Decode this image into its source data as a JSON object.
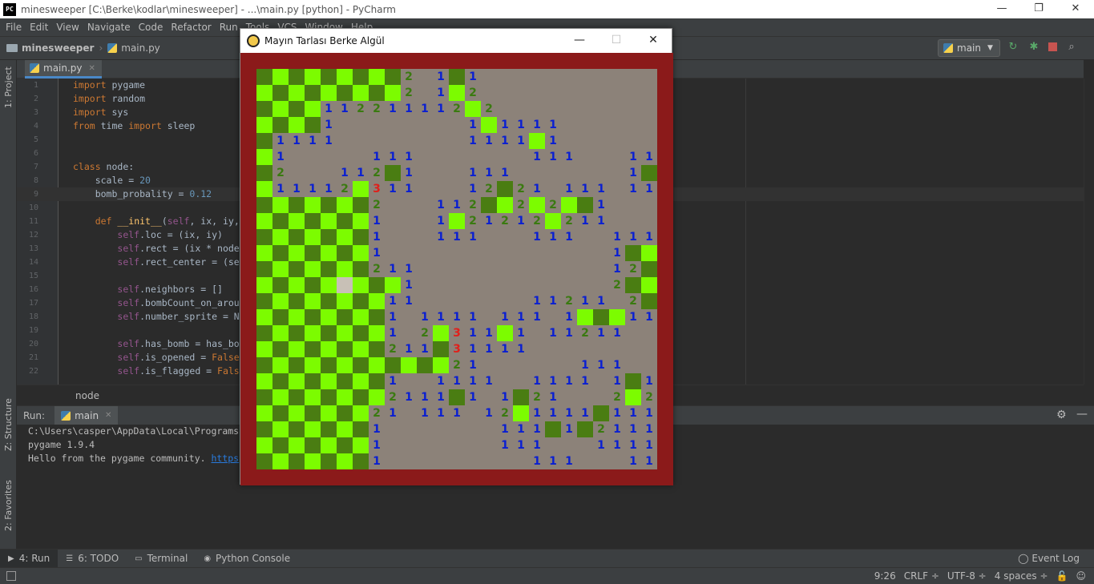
{
  "window": {
    "title": "minesweeper [C:\\Berke\\kodlar\\minesweeper] - ...\\main.py [python] - PyCharm",
    "app_icon": "PC",
    "minimize": "—",
    "maximize": "❐",
    "close": "✕"
  },
  "menu": [
    "File",
    "Edit",
    "View",
    "Navigate",
    "Code",
    "Refactor",
    "Run",
    "Tools",
    "VCS",
    "Window",
    "Help"
  ],
  "navbar": {
    "project": "minesweeper",
    "file": "main.py",
    "run_config": "main",
    "run_config_caret": "▼"
  },
  "sidebar": {
    "project_label": "1: Project",
    "structure_label": "Z: Structure",
    "favorites_label": "2: Favorites"
  },
  "editor_tab": {
    "label": "main.py",
    "close": "✕"
  },
  "code_lines": [
    {
      "n": "1",
      "html": "<span class='kw'>import</span> pygame"
    },
    {
      "n": "2",
      "html": "<span class='kw'>import</span> random"
    },
    {
      "n": "3",
      "html": "<span class='kw'>import</span> sys"
    },
    {
      "n": "4",
      "html": "<span class='kw'>from</span> time <span class='kw'>import</span> sleep"
    },
    {
      "n": "5",
      "html": ""
    },
    {
      "n": "6",
      "html": ""
    },
    {
      "n": "7",
      "html": "<span class='kw'>class</span> node:"
    },
    {
      "n": "8",
      "html": "    scale = <span class='num'>20</span>"
    },
    {
      "n": "9",
      "html": "    bomb_probality = <span class='num'>0.12</span>"
    },
    {
      "n": "10",
      "html": ""
    },
    {
      "n": "11",
      "html": "    <span class='kw'>def</span> <span class='fn'>__init__</span>(<span class='self'>self</span>, ix, iy,"
    },
    {
      "n": "12",
      "html": "        <span class='self'>self</span>.loc = (ix, iy)"
    },
    {
      "n": "13",
      "html": "        <span class='self'>self</span>.rect = (ix * node"
    },
    {
      "n": "14",
      "html": "        <span class='self'>self</span>.rect_center = (se"
    },
    {
      "n": "15",
      "html": ""
    },
    {
      "n": "16",
      "html": "        <span class='self'>self</span>.neighbors = []"
    },
    {
      "n": "17",
      "html": "        <span class='self'>self</span>.bombCount_on_arou"
    },
    {
      "n": "18",
      "html": "        <span class='self'>self</span>.number_sprite = N"
    },
    {
      "n": "19",
      "html": ""
    },
    {
      "n": "20",
      "html": "        <span class='self'>self</span>.has_bomb = has_bo"
    },
    {
      "n": "21",
      "html": "        <span class='self'>self</span>.is_opened = <span class='kw'>False</span>"
    },
    {
      "n": "22",
      "html": "        <span class='self'>self</span>.is_flagged = <span class='kw'>Fals</span>"
    }
  ],
  "editor_breadcrumb": "node",
  "run_panel": {
    "label": "Run:",
    "tab": "main",
    "tab_close": "✕",
    "lines": [
      "C:\\Users\\casper\\AppData\\Local\\Programs",
      "pygame 1.9.4"
    ],
    "hello_text": "Hello from the pygame community. ",
    "hello_link": "https"
  },
  "bottom_tabs": [
    {
      "label": "4: Run",
      "icon": "▶",
      "active": true
    },
    {
      "label": "6: TODO",
      "icon": "☰",
      "active": false
    },
    {
      "label": "Terminal",
      "icon": "▭",
      "active": false
    },
    {
      "label": "Python Console",
      "icon": "◉",
      "active": false
    }
  ],
  "event_log": "Event Log",
  "status": {
    "position": "9:26",
    "line_sep": "CRLF ÷",
    "encoding": "UTF-8 ÷",
    "indent": "4 spaces ÷"
  },
  "game": {
    "title": "Mayın Tarlası Berke Algül",
    "minimize": "—",
    "maximize": "☐",
    "close": "✕",
    "colors": {
      "dark_green": "#4a7d12",
      "light_green": "#7cfc00",
      "opened": "#8c8279",
      "flag": "#c8c0b6",
      "border": "#8b1a1a",
      "num_1": "#0a1fd1",
      "num_2": "#3a7a10",
      "num_3": "#e0201b"
    },
    "grid_cols": 25,
    "grid": [
      "#########2.1#1...........",
      "#########2.1#2...........",
      "####112211112#2..........",
      "####1........1#1111......",
      "#1111........1111#1......",
      "#1.....111.......111...11",
      "#2...112#1...111.......1#",
      "#11112#311...12#21.111.11",
      "#######2...112##2#2##1...",
      "#######1...1#21212#211...",
      "#######1...111...111..111",
      "#######1..............1##",
      "#######211............12#",
      "#####@###1............2##",
      "########11.......11211.2#",
      "########1.1111.111.1###11",
      "########1.2#311#1.11211..",
      "########211#31111........",
      "############21......111..",
      "########1..1111..1111.1#1",
      "########2111#1.1#21...2#2",
      "#######21.111.12#1111#111",
      "#######1.......111#1#2111",
      "#######1.......111...1111",
      "#######1.........111...11"
    ]
  }
}
